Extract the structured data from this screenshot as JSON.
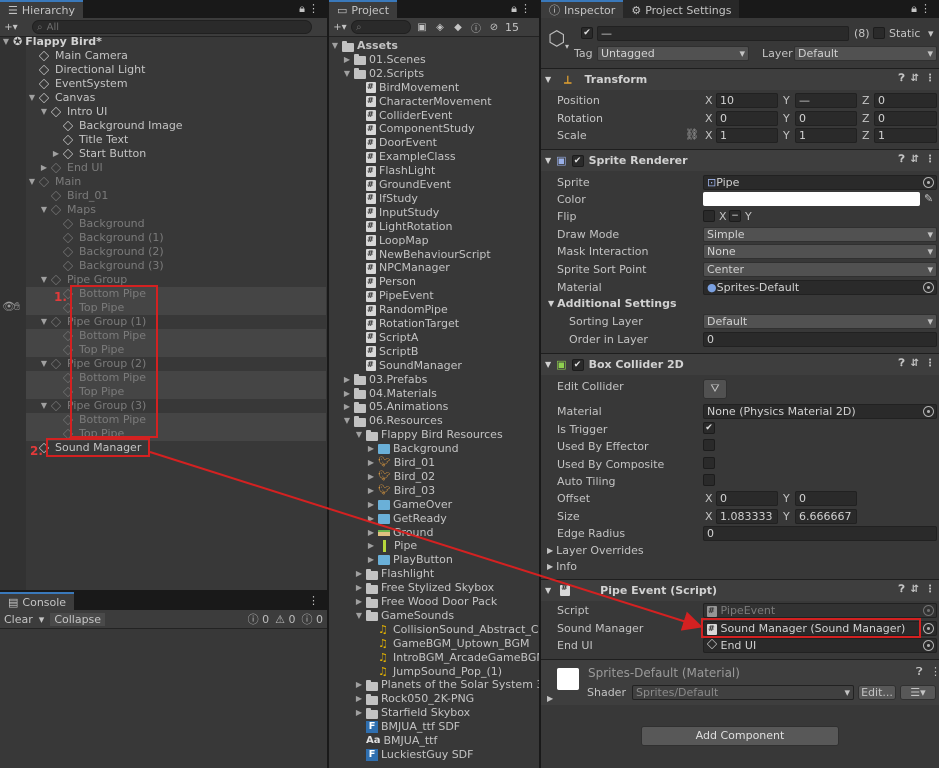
{
  "hierarchy": {
    "tab": "Hierarchy",
    "search_placeholder": "All",
    "root": "Flappy Bird*",
    "rows": [
      {
        "label": "Main Camera"
      },
      {
        "label": "Directional Light"
      },
      {
        "label": "EventSystem"
      },
      {
        "label": "Canvas"
      },
      {
        "label": "Intro UI"
      },
      {
        "label": "Background Image"
      },
      {
        "label": "Title Text"
      },
      {
        "label": "Start Button"
      },
      {
        "label": "End UI"
      },
      {
        "label": "Main"
      },
      {
        "label": "Bird_01"
      },
      {
        "label": "Maps"
      },
      {
        "label": "Background"
      },
      {
        "label": "Background (1)"
      },
      {
        "label": "Background (2)"
      },
      {
        "label": "Background (3)"
      },
      {
        "label": "Pipe Group"
      },
      {
        "label": "Bottom Pipe"
      },
      {
        "label": "Top Pipe"
      },
      {
        "label": "Pipe Group (1)"
      },
      {
        "label": "Bottom Pipe"
      },
      {
        "label": "Top Pipe"
      },
      {
        "label": "Pipe Group (2)"
      },
      {
        "label": "Bottom Pipe"
      },
      {
        "label": "Top Pipe"
      },
      {
        "label": "Pipe Group (3)"
      },
      {
        "label": "Bottom Pipe"
      },
      {
        "label": "Top Pipe"
      },
      {
        "label": "Sound Manager"
      }
    ],
    "annotation_1": "1.",
    "annotation_2": "2."
  },
  "console": {
    "tab": "Console",
    "clear": "Clear",
    "collapse": "Collapse",
    "count_log": "0",
    "count_warn": "0",
    "count_error": "0"
  },
  "project": {
    "tab": "Project",
    "hidden_count": "15",
    "rows": [
      {
        "label": "Assets"
      },
      {
        "label": "01.Scenes"
      },
      {
        "label": "02.Scripts"
      },
      {
        "label": "BirdMovement"
      },
      {
        "label": "CharacterMovement"
      },
      {
        "label": "ColliderEvent"
      },
      {
        "label": "ComponentStudy"
      },
      {
        "label": "DoorEvent"
      },
      {
        "label": "ExampleClass"
      },
      {
        "label": "FlashLight"
      },
      {
        "label": "GroundEvent"
      },
      {
        "label": "IfStudy"
      },
      {
        "label": "InputStudy"
      },
      {
        "label": "LightRotation"
      },
      {
        "label": "LoopMap"
      },
      {
        "label": "NewBehaviourScript"
      },
      {
        "label": "NPCManager"
      },
      {
        "label": "Person"
      },
      {
        "label": "PipeEvent"
      },
      {
        "label": "RandomPipe"
      },
      {
        "label": "RotationTarget"
      },
      {
        "label": "ScriptA"
      },
      {
        "label": "ScriptB"
      },
      {
        "label": "SoundManager"
      },
      {
        "label": "03.Prefabs"
      },
      {
        "label": "04.Materials"
      },
      {
        "label": "05.Animations"
      },
      {
        "label": "06.Resources"
      },
      {
        "label": "Flappy Bird Resources"
      },
      {
        "label": "Background"
      },
      {
        "label": "Bird_01"
      },
      {
        "label": "Bird_02"
      },
      {
        "label": "Bird_03"
      },
      {
        "label": "GameOver"
      },
      {
        "label": "GetReady"
      },
      {
        "label": "Ground"
      },
      {
        "label": "Pipe"
      },
      {
        "label": "PlayButton"
      },
      {
        "label": "Flashlight"
      },
      {
        "label": "Free Stylized Skybox"
      },
      {
        "label": "Free Wood Door Pack"
      },
      {
        "label": "GameSounds"
      },
      {
        "label": "CollisionSound_Abstract_Clic"
      },
      {
        "label": "GameBGM_Uptown_BGM"
      },
      {
        "label": "IntroBGM_ArcadeGameBGM1"
      },
      {
        "label": "JumpSound_Pop_(1)"
      },
      {
        "label": "Planets of the Solar System 3D"
      },
      {
        "label": "Rock050_2K-PNG"
      },
      {
        "label": "Starfield Skybox"
      },
      {
        "label": "BMJUA_ttf SDF"
      },
      {
        "label": "BMJUA_ttf"
      },
      {
        "label": "LuckiestGuy SDF"
      }
    ]
  },
  "inspector": {
    "tab": "Inspector",
    "tab2": "Project Settings",
    "name": "—",
    "multi_count": "(8)",
    "static": "Static",
    "tag_label": "Tag",
    "tag": "Untagged",
    "layer_label": "Layer",
    "layer": "Default",
    "transform": {
      "title": "Transform",
      "position": "Position",
      "pos_x": "10",
      "pos_y": "—",
      "pos_z": "0",
      "rotation": "Rotation",
      "rot_x": "0",
      "rot_y": "0",
      "rot_z": "0",
      "scale": "Scale",
      "scale_x": "1",
      "scale_y": "1",
      "scale_z": "1"
    },
    "sprite_renderer": {
      "title": "Sprite Renderer",
      "sprite": "Sprite",
      "sprite_val": "Pipe",
      "color": "Color",
      "flip": "Flip",
      "flip_x": "X",
      "flip_y": "Y",
      "draw_mode": "Draw Mode",
      "draw_mode_val": "Simple",
      "mask": "Mask Interaction",
      "mask_val": "None",
      "sort_point": "Sprite Sort Point",
      "sort_point_val": "Center",
      "material": "Material",
      "material_val": "Sprites-Default",
      "additional": "Additional Settings",
      "sorting_layer": "Sorting Layer",
      "sorting_layer_val": "Default",
      "order": "Order in Layer",
      "order_val": "0"
    },
    "box_collider": {
      "title": "Box Collider 2D",
      "edit": "Edit Collider",
      "material": "Material",
      "material_val": "None (Physics Material 2D)",
      "is_trigger": "Is Trigger",
      "used_by_effector": "Used By Effector",
      "used_by_composite": "Used By Composite",
      "auto_tiling": "Auto Tiling",
      "offset": "Offset",
      "off_x": "0",
      "off_y": "0",
      "size": "Size",
      "size_x": "1.083333",
      "size_y": "6.666667",
      "edge_radius": "Edge Radius",
      "edge_radius_val": "0",
      "layer_overrides": "Layer Overrides",
      "info": "Info"
    },
    "pipe_event": {
      "title": "Pipe Event (Script)",
      "script": "Script",
      "script_val": "PipeEvent",
      "sound_manager": "Sound Manager",
      "sound_manager_val": "Sound Manager (Sound Manager)",
      "end_ui": "End UI",
      "end_ui_val": "End UI"
    },
    "material_block": {
      "title": "Sprites-Default (Material)",
      "shader": "Shader",
      "shader_val": "Sprites/Default",
      "edit": "Edit..."
    },
    "add_component": "Add Component"
  },
  "colors": {
    "highlight": "#d42121",
    "accent": "#3a79bb"
  }
}
